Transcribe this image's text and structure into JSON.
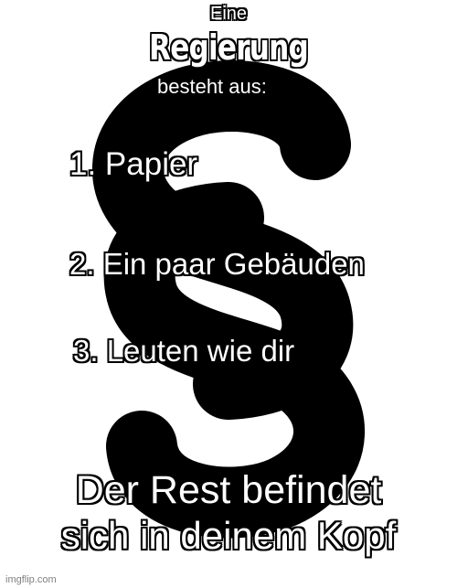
{
  "meme": {
    "intro": "Eine",
    "subject": "Regierung",
    "predicate": "besteht aus:",
    "items": [
      "1. Papier",
      "2. Ein paar Gebäuden",
      "3. Leuten wie dir"
    ],
    "conclusion": [
      "Der Rest befindet",
      "sich in deinem Kopf"
    ],
    "watermark": "imgflip.com"
  },
  "colors": {
    "background": "#ffffff",
    "symbol": "#000000",
    "text": "#ffffff",
    "outline": "#000000"
  },
  "icons": {
    "background_symbol": "section-sign-icon"
  }
}
